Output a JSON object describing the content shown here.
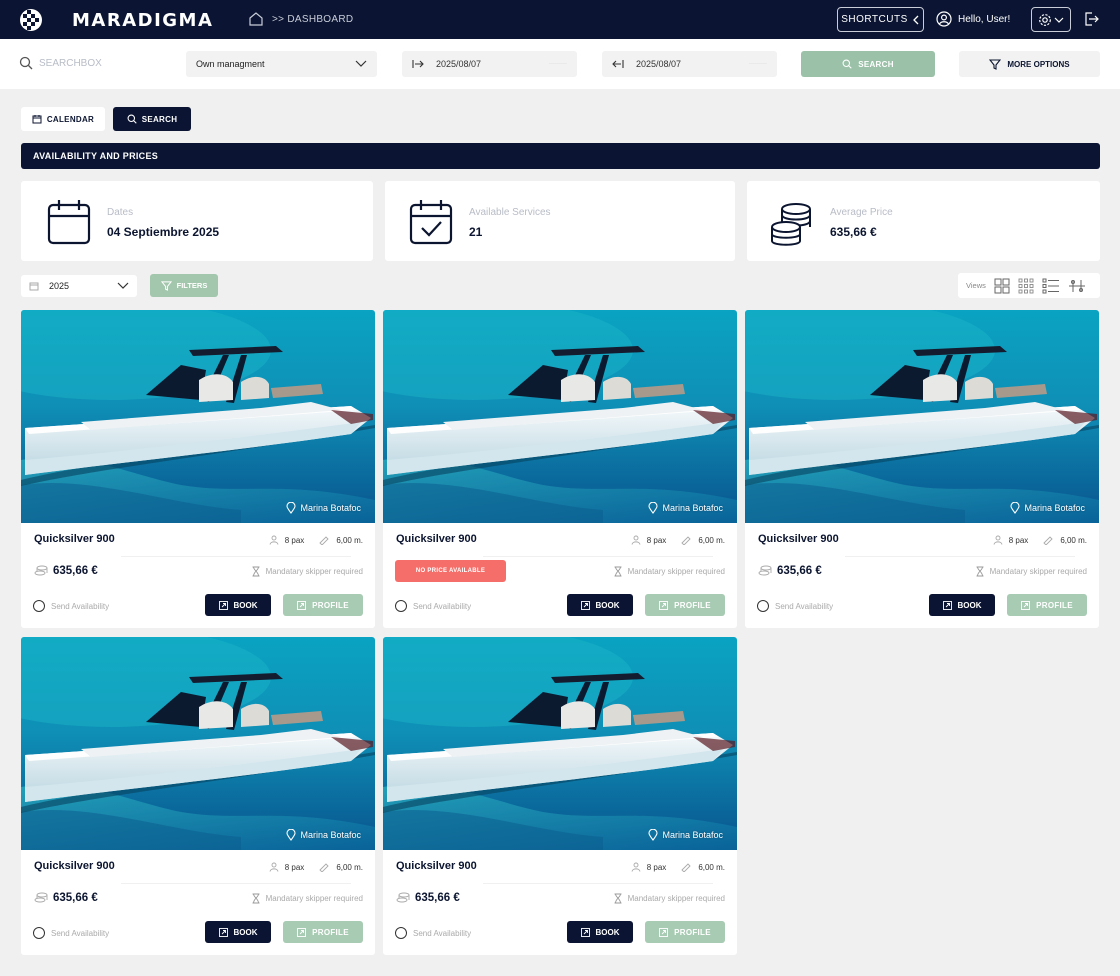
{
  "nav": {
    "brand": "MARADIGMA",
    "breadcrumb": ">> DASHBOARD",
    "shortcuts_label": "SHORTCUTS",
    "greeting": "Hello, User!"
  },
  "search": {
    "placeholder": "SEARCHBOX",
    "management": "Own managment",
    "date_from": "2025/08/07",
    "date_to": "2025/08/07",
    "search_label": "SEARCH",
    "more_options_label": "MORE OPTIONS"
  },
  "tabs": {
    "calendar_label": "CALENDAR",
    "search_label": "SEARCH"
  },
  "banner": "AVAILABILITY AND PRICES",
  "stats": [
    {
      "label": "Dates",
      "value": "04 Septiembre 2025",
      "icon": "calendar-icon"
    },
    {
      "label": "Available Services",
      "value": "21",
      "icon": "calendar-check-icon"
    },
    {
      "label": "Average Price",
      "value": "635,66 €",
      "icon": "coins-icon"
    }
  ],
  "filters": {
    "year": "2025",
    "filters_label": "FILTERS",
    "views_label": "Views"
  },
  "cards": [
    {
      "name": "Quicksilver 900",
      "location": "Marina Botafoc",
      "pax": "8 pax",
      "length": "6,00 m.",
      "price": "635,66 €",
      "skipper": "Mandatary skipper required",
      "send": "Send Availability",
      "book": "BOOK",
      "profile": "PROFILE"
    },
    {
      "name": "Quicksilver 900",
      "location": "Marina Botafoc",
      "pax": "8 pax",
      "length": "6,00 m.",
      "no_price": "NO PRICE AVAILABLE",
      "skipper": "Mandatary skipper required",
      "send": "Send Availability",
      "book": "BOOK",
      "profile": "PROFILE"
    },
    {
      "name": "Quicksilver 900",
      "location": "Marina Botafoc",
      "pax": "8 pax",
      "length": "6,00 m.",
      "price": "635,66 €",
      "skipper": "Mandatary skipper required",
      "send": "Send Availability",
      "book": "BOOK",
      "profile": "PROFILE"
    },
    {
      "name": "Quicksilver 900",
      "location": "Marina Botafoc",
      "pax": "8 pax",
      "length": "6,00 m.",
      "price": "635,66 €",
      "skipper": "Mandatary skipper required",
      "send": "Send Availability",
      "book": "BOOK",
      "profile": "PROFILE"
    },
    {
      "name": "Quicksilver 900",
      "location": "Marina Botafoc",
      "pax": "8 pax",
      "length": "6,00 m.",
      "price": "635,66 €",
      "skipper": "Mandatary skipper required",
      "send": "Send Availability",
      "book": "BOOK",
      "profile": "PROFILE"
    }
  ]
}
